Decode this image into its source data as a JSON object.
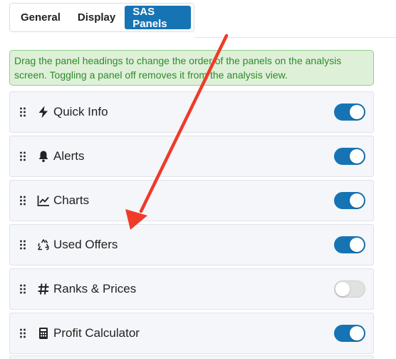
{
  "tabs": [
    {
      "label": "General",
      "active": false
    },
    {
      "label": "Display",
      "active": false
    },
    {
      "label": "SAS Panels",
      "active": true
    }
  ],
  "notice": {
    "text": "Drag the panel headings to change the order of the panels on the analysis screen. Toggling a panel off removes it from the analysis view."
  },
  "panels": [
    {
      "label": "Quick Info",
      "icon": "lightning-icon",
      "enabled": true
    },
    {
      "label": "Alerts",
      "icon": "bell-icon",
      "enabled": true
    },
    {
      "label": "Charts",
      "icon": "line-chart-icon",
      "enabled": true
    },
    {
      "label": "Used Offers",
      "icon": "recycle-icon",
      "enabled": true
    },
    {
      "label": "Ranks & Prices",
      "icon": "hashtag-icon",
      "enabled": false
    },
    {
      "label": "Profit Calculator",
      "icon": "calculator-icon",
      "enabled": true
    }
  ],
  "colors": {
    "accent": "#1674b4",
    "notice_bg": "#dff0d8",
    "notice_text": "#2e8a2e",
    "annotation_arrow": "#f03a2a"
  }
}
